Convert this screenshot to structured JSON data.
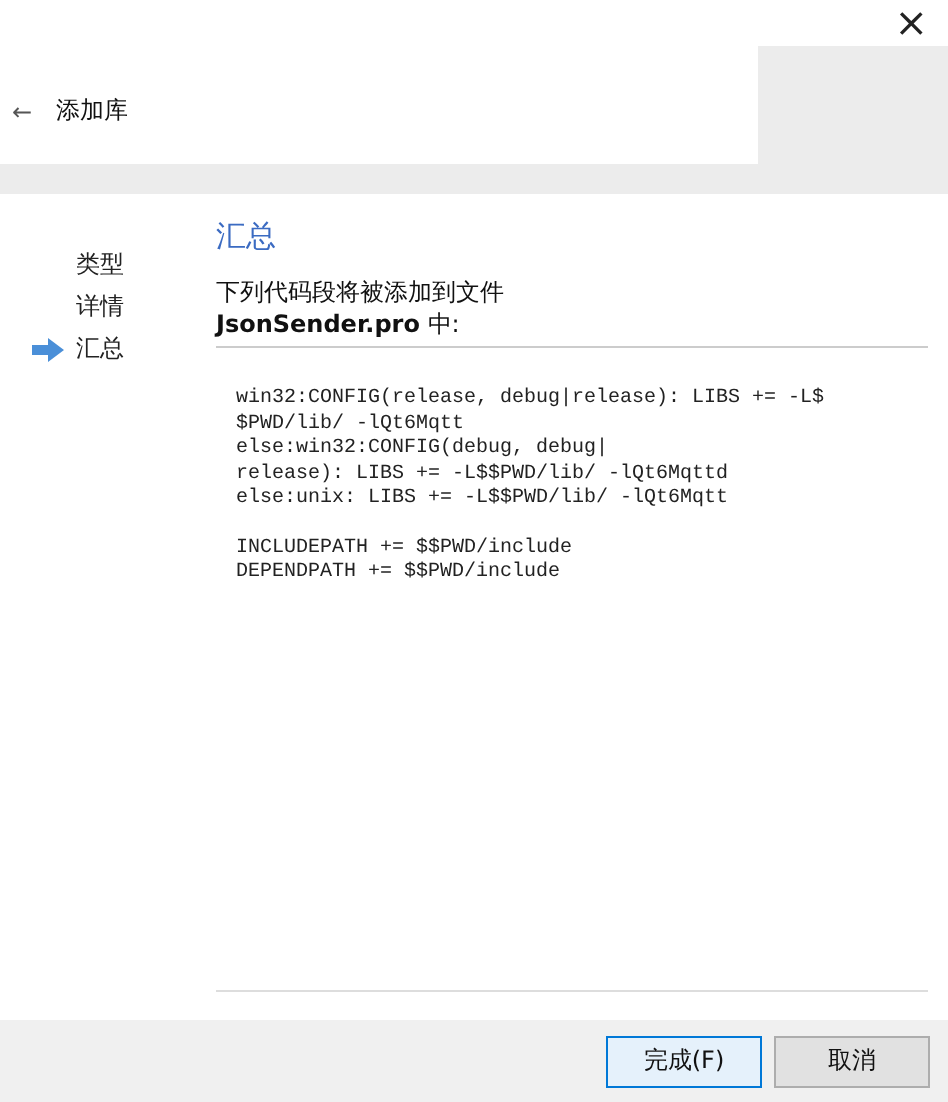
{
  "window": {
    "close": "×"
  },
  "header": {
    "back": "←",
    "title": "添加库"
  },
  "steps": [
    {
      "label": "类型",
      "selected": false
    },
    {
      "label": "详情",
      "selected": false
    },
    {
      "label": "汇总",
      "selected": true
    }
  ],
  "page": {
    "heading": "汇总",
    "description": "下列代码段将被添加到文件\n**JsonSender.pro** 中:",
    "code_blocks": [
      [
        "win32:CONFIG(release, debug|release): LIBS += -L$",
        "$PWD/lib/ -lQt6Mqtt",
        "else:win32:CONFIG(debug, debug|",
        "release): LIBS += -L$$PWD/lib/ -lQt6Mqttd",
        "else:unix: LIBS += -L$$PWD/lib/ -lQt6Mqtt"
      ],
      [
        "INCLUDEPATH += $$PWD/include",
        "DEPENDPATH += $$PWD/include"
      ]
    ]
  },
  "buttons": [
    {
      "label": "完成(F)",
      "focused": true
    },
    {
      "label": "取消",
      "focused": false
    }
  ]
}
